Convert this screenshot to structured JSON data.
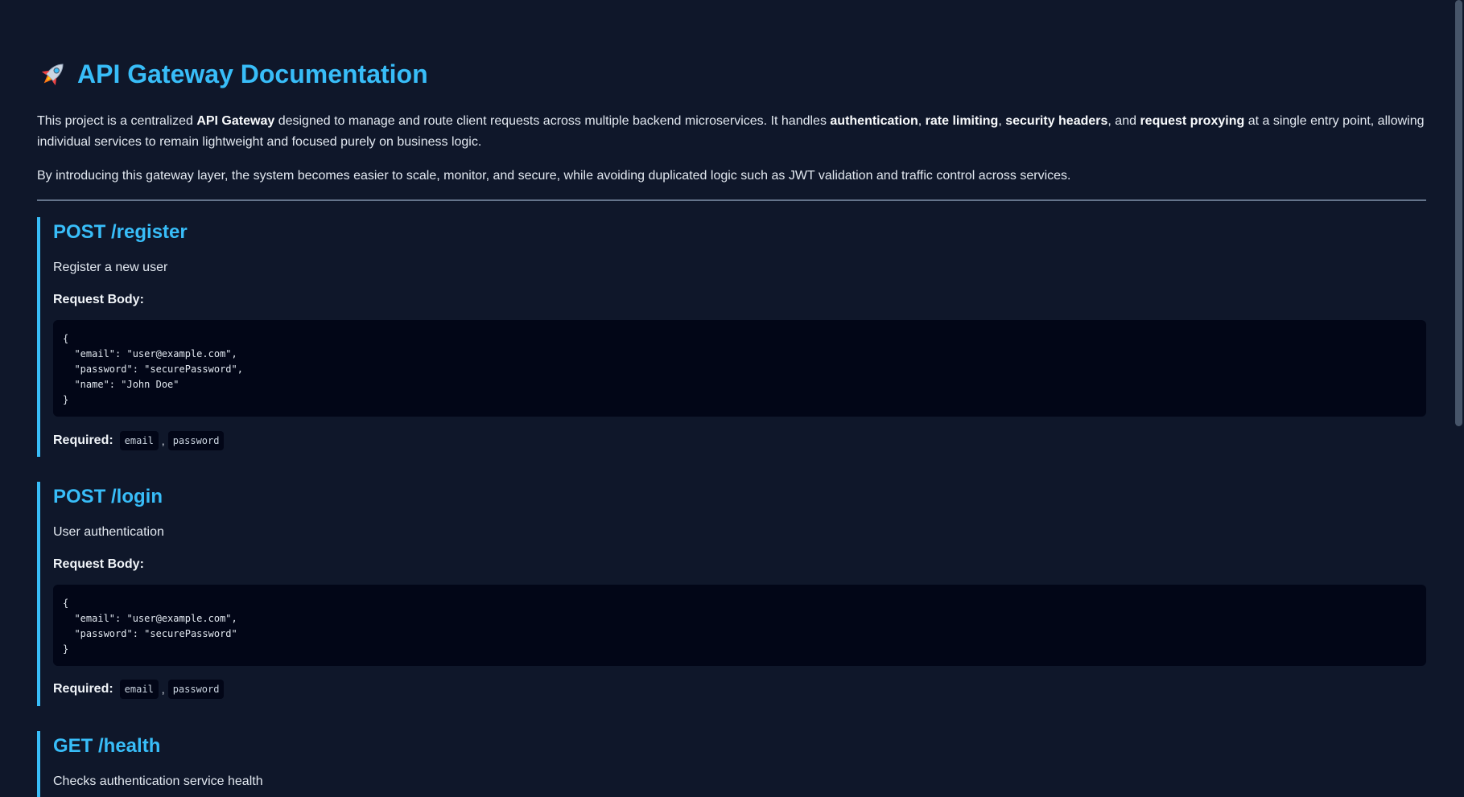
{
  "title": {
    "emoji_icon": "rocket-icon",
    "text": "API Gateway Documentation"
  },
  "intro": {
    "p1_a": "This project is a centralized ",
    "p1_b": "API Gateway",
    "p1_c": " designed to manage and route client requests across multiple backend microservices. It handles ",
    "p1_d": "authentication",
    "p1_e": ", ",
    "p1_f": "rate limiting",
    "p1_g": ", ",
    "p1_h": "security headers",
    "p1_i": ", and ",
    "p1_j": "request proxying",
    "p1_k": " at a single entry point, allowing individual services to remain lightweight and focused purely on business logic.",
    "p2": "By introducing this gateway layer, the system becomes easier to scale, monitor, and secure, while avoiding duplicated logic such as JWT validation and traffic control across services."
  },
  "endpoints": [
    {
      "heading": "POST /register",
      "description": "Register a new user",
      "body_label": "Request Body:",
      "code": "{\n  \"email\": \"user@example.com\",\n  \"password\": \"securePassword\",\n  \"name\": \"John Doe\"\n}",
      "required_label": "Required:",
      "required": [
        "email",
        "password"
      ]
    },
    {
      "heading": "POST /login",
      "description": "User authentication",
      "body_label": "Request Body:",
      "code": "{\n  \"email\": \"user@example.com\",\n  \"password\": \"securePassword\"\n}",
      "required_label": "Required:",
      "required": [
        "email",
        "password"
      ]
    },
    {
      "heading": "GET /health",
      "description": "Checks authentication service health"
    }
  ],
  "colors": {
    "background": "#0f172a",
    "accent": "#38bdf8",
    "code_background": "#020617"
  }
}
